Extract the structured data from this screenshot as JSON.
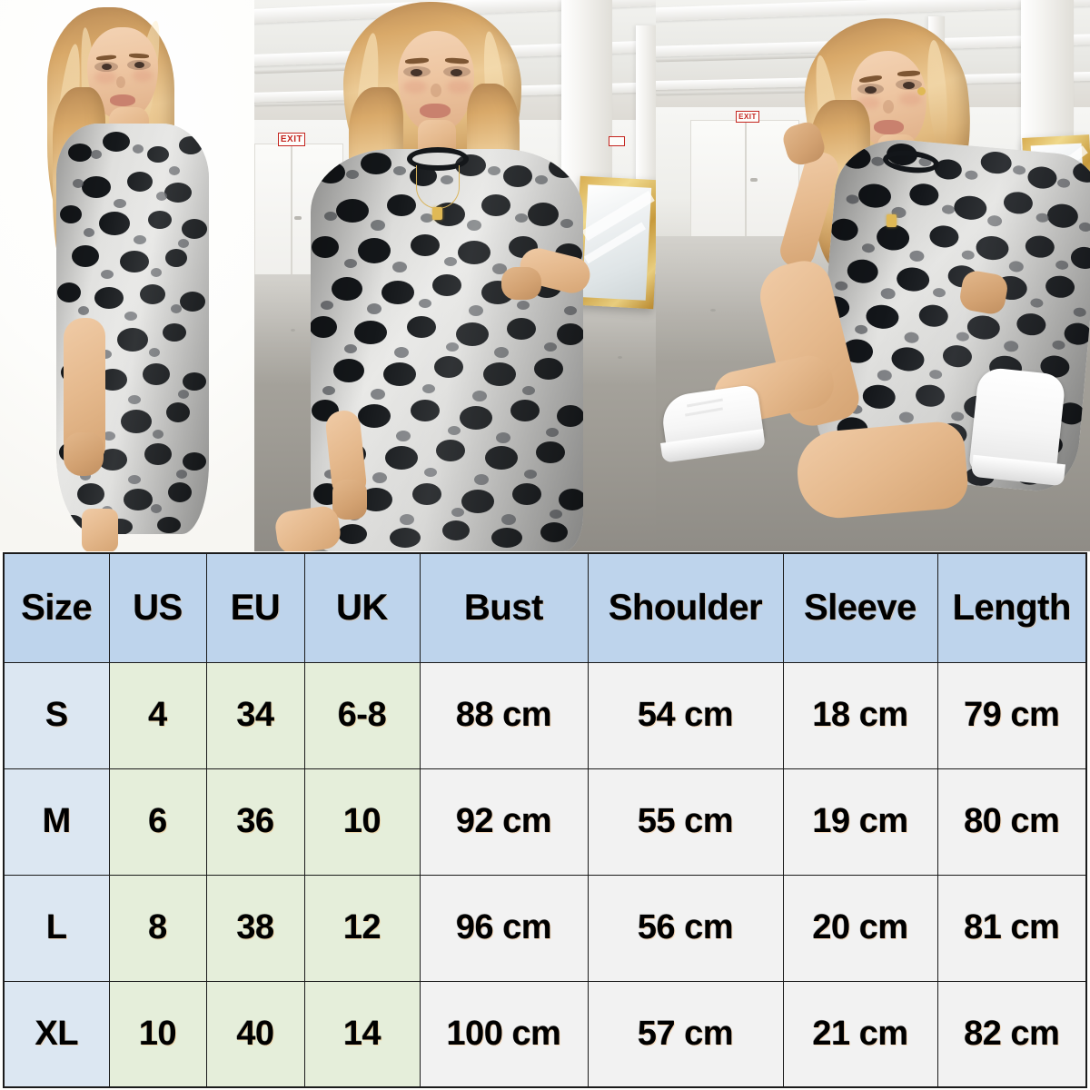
{
  "product": {
    "name": "Leopard print short-sleeve t-shirt dress",
    "print": "silver-grey leopard",
    "photos": [
      {
        "id": "photo-side-view",
        "alt": "Model side/back view wearing leopard print t-shirt dress on white studio backdrop",
        "setting": "white studio backdrop",
        "pose": "side-back view looking over shoulder"
      },
      {
        "id": "photo-front-view",
        "alt": "Model front view hand on hip wearing leopard print t-shirt dress in industrial loft",
        "setting": "industrial loft with concrete floor, white columns and gold framed mirror",
        "pose": "standing, hand on hip",
        "exit_sign_label": "EXIT"
      },
      {
        "id": "photo-kneeling-view",
        "alt": "Model kneeling wearing leopard print t-shirt dress with white chunky sneakers",
        "setting": "industrial loft with concrete floor, white columns and gold framed mirror",
        "pose": "kneeling, hand in hair",
        "exit_sign_label": "EXIT",
        "footwear": "white chunky sneakers"
      }
    ]
  },
  "size_table": {
    "headers": [
      "Size",
      "US",
      "EU",
      "UK",
      "Bust",
      "Shoulder",
      "Sleeve",
      "Length"
    ],
    "rows": [
      {
        "size": "S",
        "us": "4",
        "eu": "34",
        "uk": "6-8",
        "bust": "88 cm",
        "shoulder": "54 cm",
        "sleeve": "18 cm",
        "length": "79 cm"
      },
      {
        "size": "M",
        "us": "6",
        "eu": "36",
        "uk": "10",
        "bust": "92 cm",
        "shoulder": "55 cm",
        "sleeve": "19 cm",
        "length": "80 cm"
      },
      {
        "size": "L",
        "us": "8",
        "eu": "38",
        "uk": "12",
        "bust": "96 cm",
        "shoulder": "56 cm",
        "sleeve": "20 cm",
        "length": "81 cm"
      },
      {
        "size": "XL",
        "us": "10",
        "eu": "40",
        "uk": "14",
        "bust": "100 cm",
        "shoulder": "57 cm",
        "sleeve": "21 cm",
        "length": "82 cm"
      }
    ]
  },
  "colors": {
    "header_blue": "#bed4ec",
    "size_cell_blue": "#dce7f2",
    "region_cell_green": "#e5eeda",
    "measure_cell_grey": "#f2f2f2",
    "grid_line": "#1b1b1b",
    "text": "#000000",
    "exit_sign_red": "#c4251f",
    "mirror_gold": "#d8ad52"
  }
}
